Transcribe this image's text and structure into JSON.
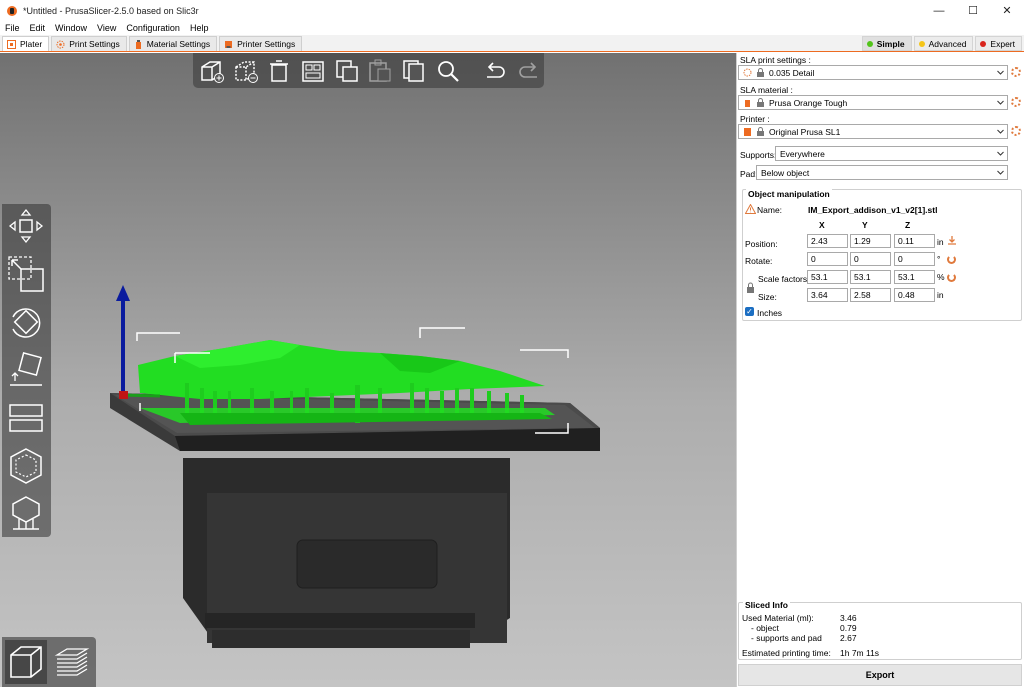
{
  "window": {
    "title": "*Untitled - PrusaSlicer-2.5.0 based on Slic3r",
    "controls": [
      "—",
      "☐",
      "✕"
    ]
  },
  "menu": [
    "File",
    "Edit",
    "Window",
    "View",
    "Configuration",
    "Help"
  ],
  "tabs": [
    {
      "label": "Plater",
      "active": true
    },
    {
      "label": "Print Settings",
      "active": false
    },
    {
      "label": "Material Settings",
      "active": false
    },
    {
      "label": "Printer Settings",
      "active": false
    }
  ],
  "modes": [
    {
      "label": "Simple",
      "color": "#52c41a",
      "active": true
    },
    {
      "label": "Advanced",
      "color": "#f5c518",
      "active": false
    },
    {
      "label": "Expert",
      "color": "#d9251d",
      "active": false
    }
  ],
  "toolbar_icons": [
    "add-icon",
    "delete-icon",
    "delete-all-icon",
    "arrange-icon",
    "copy-icon",
    "paste-icon",
    "instances-icon",
    "search-icon",
    "undo-icon",
    "redo-icon"
  ],
  "gizmo_icons": [
    "move-icon",
    "scale-icon",
    "rotate-icon",
    "place-on-face-icon",
    "cut-icon",
    "hollow-icon",
    "support-points-icon"
  ],
  "sidebar": {
    "print_settings_label": "SLA print settings :",
    "print_settings_value": "0.035 Detail",
    "material_label": "SLA material :",
    "material_value": "Prusa Orange Tough",
    "printer_label": "Printer :",
    "printer_value": "Original Prusa SL1",
    "supports_label": "Supports:",
    "supports_value": "Everywhere",
    "pad_label": "Pad:",
    "pad_value": "Below object"
  },
  "object_manipulation": {
    "title": "Object manipulation",
    "name_label": "Name:",
    "name_value": "IM_Export_addison_v1_v2[1].stl",
    "col_x": "X",
    "col_y": "Y",
    "col_z": "Z",
    "position_label": "Position:",
    "position": [
      "2.43",
      "1.29",
      "0.11"
    ],
    "position_unit": "in",
    "rotate_label": "Rotate:",
    "rotate": [
      "0",
      "0",
      "0"
    ],
    "rotate_unit": "°",
    "scale_label": "Scale factors:",
    "scale": [
      "53.1",
      "53.1",
      "53.1"
    ],
    "scale_unit": "%",
    "size_label": "Size:",
    "size": [
      "3.64",
      "2.58",
      "0.48"
    ],
    "size_unit": "in",
    "inches_label": "Inches",
    "inches_checked": true
  },
  "sliced_info": {
    "title": "Sliced Info",
    "used_material_label": "Used Material (ml):",
    "used_material_value": "3.46",
    "object_label": "- object",
    "object_value": "0.79",
    "supports_label": "- supports and pad",
    "supports_value": "2.67",
    "time_label": "Estimated printing time:",
    "time_value": "1h 7m 11s"
  },
  "export_label": "Export",
  "colors": {
    "accent": "#ed6b21",
    "model_green": "#22dd22",
    "bed": "#2a2a2a"
  }
}
